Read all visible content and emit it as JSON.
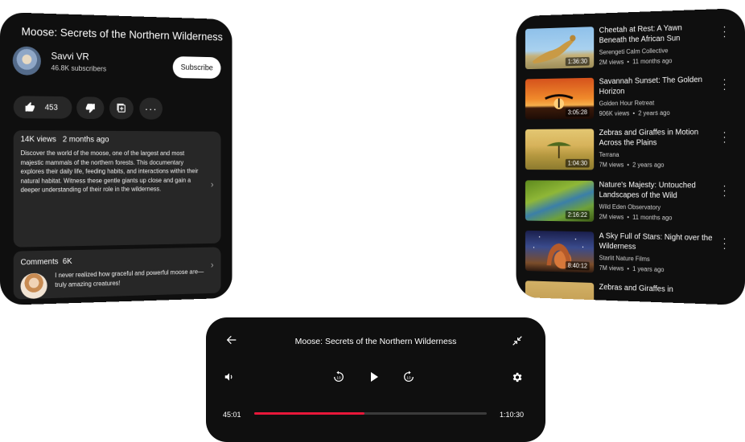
{
  "colors": {
    "panel_bg": "#0f0f0f",
    "card_bg": "#272727",
    "accent": "#e8173a"
  },
  "details": {
    "title": "Moose: Secrets of the Northern Wilderness",
    "channel": {
      "name": "Savvi VR",
      "subscribers": "46.8K subscribers",
      "subscribe_label": "Subscribe",
      "avatar_icon": "channel-avatar"
    },
    "actions": {
      "like_count": "453",
      "like_icon": "thumbs-up-icon",
      "dislike_icon": "thumbs-down-icon",
      "save_icon": "add-to-playlist-icon",
      "more_label": "···"
    },
    "description": {
      "views": "14K views",
      "age": "2 months ago",
      "text": "Discover the world of the moose, one of the largest and most majestic mammals of the northern forests. This documentary explores their daily life, feeding habits, and interactions within their natural habitat. Witness these gentle giants up close and gain a deeper understanding of their role in the wilderness."
    },
    "comments": {
      "label": "Comments",
      "count": "6K",
      "top_comment": "I never realized how graceful and powerful moose are—truly amazing creatures!"
    }
  },
  "recommendations": [
    {
      "title": "Cheetah at Rest: A Yawn Beneath the African Sun",
      "channel": "Serengeti Calm Collective",
      "views": "2M views",
      "age": "11 months ago",
      "duration": "1:36:30",
      "thumb": "cheetah"
    },
    {
      "title": "Savannah Sunset: The Golden Horizon",
      "channel": "Golden Hour Retreat",
      "views": "906K views",
      "age": "2 years ago",
      "duration": "3:05:28",
      "thumb": "sunset"
    },
    {
      "title": "Zebras and Giraffes in Motion Across the Plains",
      "channel": "Terrana",
      "views": "7M views",
      "age": "2 years ago",
      "duration": "1:04:30",
      "thumb": "zebras"
    },
    {
      "title": "Nature's Majesty: Untouched Landscapes of the Wild",
      "channel": "Wild Eden Observatory",
      "views": "2M views",
      "age": "11 months ago",
      "duration": "2:16:22",
      "thumb": "majesty"
    },
    {
      "title": "A Sky Full of Stars: Night over the Wilderness",
      "channel": "Starlit Nature Films",
      "views": "7M views",
      "age": "1 years ago",
      "duration": "8:40:12",
      "thumb": "stars"
    },
    {
      "title": "Zebras and Giraffes in",
      "channel": "",
      "views": "",
      "age": "",
      "duration": "",
      "thumb": "zebras2"
    }
  ],
  "player": {
    "title": "Moose: Secrets of the Northern Wilderness",
    "current_time": "45:01",
    "total_time": "1:10:30",
    "progress": 0.475,
    "icons": [
      "back-arrow-icon",
      "collapse-icon",
      "volume-icon",
      "rewind-10-icon",
      "play-icon",
      "forward-10-icon",
      "settings-icon"
    ]
  }
}
